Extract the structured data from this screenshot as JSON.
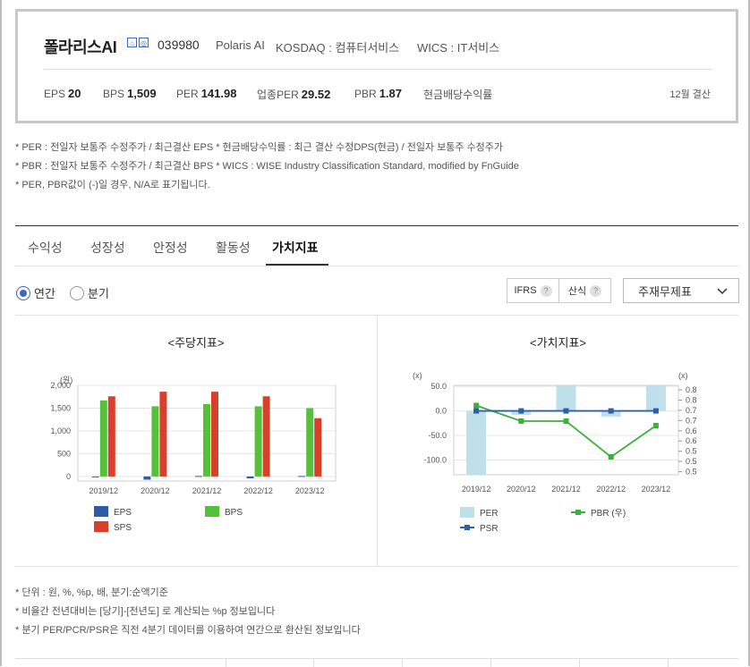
{
  "company": {
    "name": "폴라리스AI",
    "code": "039980",
    "english_name": "Polaris AI",
    "market": "KOSDAQ : 컴퓨터서비스",
    "wics": "WICS : IT서비스",
    "settlement": "12월 결산",
    "icon1": "home-icon",
    "icon2": "web-icon"
  },
  "metrics": [
    {
      "label": "EPS",
      "value": "20"
    },
    {
      "label": "BPS",
      "value": "1,509"
    },
    {
      "label": "PER",
      "value": "141.98"
    },
    {
      "label": "업종PER",
      "value": "29.52"
    },
    {
      "label": "PBR",
      "value": "1.87"
    },
    {
      "label": "현금배당수익률",
      "value": ""
    }
  ],
  "notes": [
    "* PER : 전일자 보통주 수정주가 / 최근결산 EPS * 현금배당수익률 : 최근 결산 수정DPS(현금) / 전일자 보통주 수정주가",
    "* PBR : 전일자 보통주 수정주가 / 최근결산 BPS * WICS : WISE Industry Classification Standard, modified by FnGuide",
    "* PER, PBR값이 (-)일 경우, N/A로 표기됩니다."
  ],
  "tabs": [
    "수익성",
    "성장성",
    "안정성",
    "활동성",
    "가치지표"
  ],
  "active_tab": "가치지표",
  "period": {
    "annual": "연간",
    "quarter": "분기",
    "selected": "연간"
  },
  "buttons": {
    "ifrs": "IFRS",
    "ifrs_help": "?",
    "formula": "산식",
    "formula_help": "?"
  },
  "dropdown": {
    "selected": "주재무제표"
  },
  "colors": {
    "accent": "#3b66c4",
    "eps": "#2e5aa8",
    "bps": "#55c03a",
    "sps": "#d9402b",
    "per": "#bfe0ea",
    "pbr": "#3cb03c",
    "psr": "#2f5ea8"
  },
  "chart_data": [
    {
      "type": "bar",
      "title": "<주당지표>",
      "ylabel": "(원)",
      "categories": [
        "2019/12",
        "2020/12",
        "2021/12",
        "2022/12",
        "2023/12"
      ],
      "yticks": [
        "2,000",
        "1,500",
        "1,000",
        "500",
        "0"
      ],
      "ylim": [
        -100,
        2000
      ],
      "series": [
        {
          "name": "EPS",
          "values": [
            -10,
            -70,
            10,
            -40,
            10
          ]
        },
        {
          "name": "BPS",
          "values": [
            1670,
            1540,
            1590,
            1540,
            1500
          ]
        },
        {
          "name": "SPS",
          "values": [
            1760,
            1860,
            1860,
            1760,
            1280
          ]
        }
      ],
      "legend": "bottom",
      "grid": true
    },
    {
      "type": "bar+line",
      "title": "<가치지표>",
      "ylabel_left": "(x)",
      "ylabel_right": "(x)",
      "categories": [
        "2019/12",
        "2020/12",
        "2021/12",
        "2022/12",
        "2023/12"
      ],
      "yticks_left": [
        "50.0",
        "0.0",
        "-50.0",
        "-100.0"
      ],
      "yticks_right": [
        "0.8",
        "0.8",
        "0.7",
        "0.7",
        "0.6",
        "0.6",
        "0.5",
        "0.5",
        "0.5"
      ],
      "ylim_left": [
        -130,
        52
      ],
      "ylim_right": [
        0.5,
        0.9
      ],
      "series": [
        {
          "name": "PER",
          "axis": "left",
          "kind": "bar",
          "values": [
            -130,
            -8,
            52,
            -12,
            52
          ]
        },
        {
          "name": "PBR (우)",
          "axis": "right",
          "kind": "line",
          "values": [
            0.81,
            0.74,
            0.74,
            0.58,
            0.72
          ]
        },
        {
          "name": "PSR",
          "axis": "left",
          "kind": "line",
          "values": [
            0,
            0,
            0,
            0,
            0
          ]
        }
      ],
      "legend": "bottom",
      "grid": true
    }
  ],
  "footnotes": [
    "* 단위 : 원, %, %p, 배, 분기:순액기준",
    "* 비율간 전년대비는 [당기]-[전년도] 로 계산되는 %p 정보입니다",
    "* 분기 PER/PCR/PSR은 직전 4분기 데이터를 이용하여 연간으로 환산된 정보입니다"
  ]
}
